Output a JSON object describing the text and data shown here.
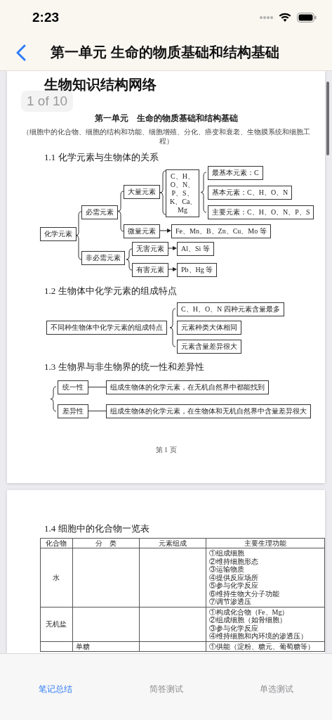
{
  "status_bar": {
    "time": "2:23"
  },
  "nav": {
    "title": "第一单元 生命的物质基础和结构基础"
  },
  "document": {
    "page_indicator": "1 of 10",
    "page_1": {
      "heading": "生物知识结构网络",
      "unit_title": "第一单元　生命的物质基础和结构基础",
      "subtitle": "（细胞中的化合物、细胞的结构和功能、细胞增殖、分化、癌变和衰老、生物膜系统和细胞工程）",
      "section_1": {
        "heading": "1.1 化学元素与生物体的关系",
        "nodes": [
          {
            "text": "化学元素"
          },
          {
            "text": "必需元素"
          },
          {
            "text": "非必需元素"
          },
          {
            "text": "大量元素"
          },
          {
            "text": "微量元素"
          },
          {
            "lines": [
              "C、H、",
              "O、N、",
              "P、S、",
              "K、Ca、",
              "Mg"
            ]
          },
          {
            "text": "最基本元素：C"
          },
          {
            "text": "基本元素：C、H、O、N"
          },
          {
            "text": "主要元素：C、H、O、N、P、S"
          },
          {
            "text": "Fe、Mn、B、Zn、Cu、Mo 等"
          },
          {
            "text": "无害元素"
          },
          {
            "text": "Al、Si 等"
          },
          {
            "text": "有害元素"
          },
          {
            "text": "Pb、Hg 等"
          }
        ]
      },
      "section_2": {
        "heading": "1.2 生物体中化学元素的组成特点",
        "nodes": [
          {
            "text": "不同种生物体中化学元素的组成特点"
          },
          {
            "text": "C、H、O、N 四种元素含量最多"
          },
          {
            "text": "元素种类大体相同"
          },
          {
            "text": "元素含量差异很大"
          }
        ]
      },
      "section_3": {
        "heading": "1.3 生物界与非生物界的统一性和差异性",
        "nodes": [
          {
            "text": "统一性"
          },
          {
            "text": "组成生物体的化学元素，在无机自然界中都能找到"
          },
          {
            "text": "差异性"
          },
          {
            "text": "组成生物体的化学元素，在生物体和无机自然界中含量差异很大"
          }
        ]
      },
      "footer": "第 1 页"
    },
    "page_2": {
      "heading": "1.4 细胞中的化合物一览表",
      "table": {
        "columns": [
          "化合物",
          "分　类",
          "元素组成",
          "主要生理功能"
        ],
        "rows": [
          {
            "compound": "水",
            "functions": [
              "①组成细胞",
              "②维持细胞形态",
              "③运输物质",
              "④提供反应场所",
              "⑤参与化学反应",
              "⑥维持生物大分子功能",
              "⑦调节渗透压"
            ]
          },
          {
            "compound": "无机盐",
            "functions": [
              "①构成化合物（Fe、Mg）",
              "②组成细胞（如骨细胞）",
              "③参与化学反应",
              "④维持细胞和内环境的渗透压）"
            ]
          },
          {
            "category": "单糖",
            "functions": [
              "①供能（淀粉、糖元、葡萄糖等）"
            ]
          }
        ]
      }
    }
  },
  "tabs": [
    {
      "label": "笔记总结",
      "selected": true
    },
    {
      "label": "简答测试",
      "selected": false
    },
    {
      "label": "单选测试",
      "selected": false
    }
  ]
}
